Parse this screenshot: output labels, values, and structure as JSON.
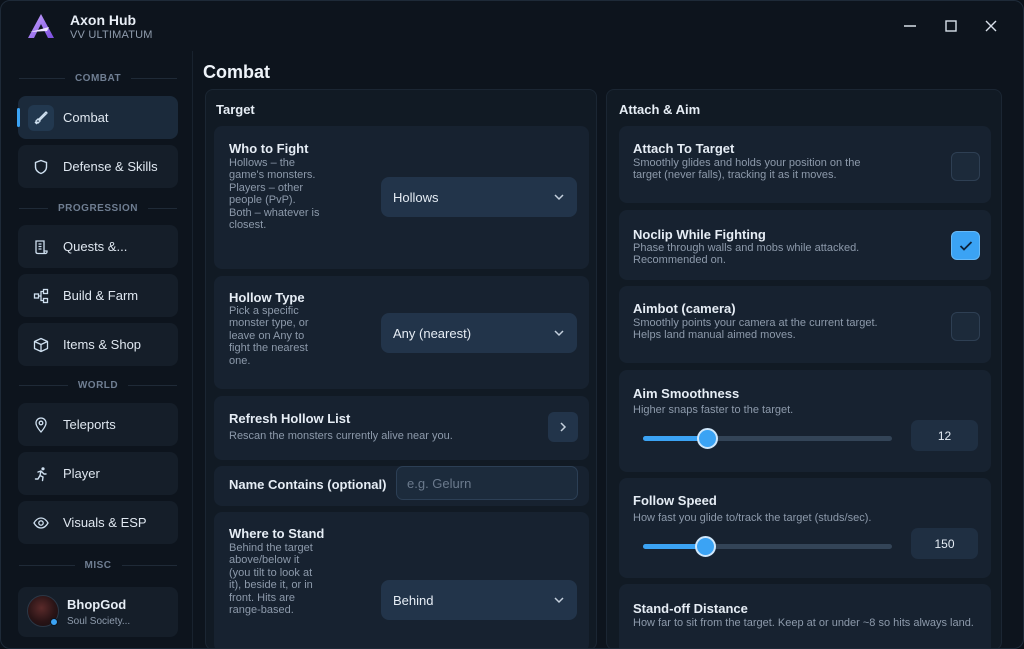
{
  "app": {
    "title": "Axon Hub",
    "subtitle": "VV ULTIMATUM"
  },
  "sidebar": {
    "sections": {
      "combat": "COMBAT",
      "progression": "PROGRESSION",
      "world": "WORLD",
      "misc": "MISC"
    },
    "items": [
      {
        "label": "Combat",
        "icon": "sword-icon",
        "active": true
      },
      {
        "label": "Defense & Skills",
        "icon": "shield-icon"
      },
      {
        "label": "Quests &...",
        "icon": "scroll-icon"
      },
      {
        "label": "Build & Farm",
        "icon": "nodes-icon"
      },
      {
        "label": "Items & Shop",
        "icon": "box-icon"
      },
      {
        "label": "Teleports",
        "icon": "location-pin-icon"
      },
      {
        "label": "Player",
        "icon": "running-person-icon"
      },
      {
        "label": "Visuals & ESP",
        "icon": "eye-icon"
      }
    ],
    "user": {
      "name": "BhopGod",
      "subtitle": "Soul Society..."
    }
  },
  "main": {
    "title": "Combat"
  },
  "target_panel": {
    "title": "Target",
    "who_to_fight": {
      "title": "Who to Fight",
      "description": "Hollows – the game's monsters. Players – other people (PvP). Both – whatever is closest.",
      "value": "Hollows"
    },
    "hollow_type": {
      "title": "Hollow Type",
      "description": "Pick a specific monster type, or leave on Any to fight the nearest one.",
      "value": "Any (nearest)"
    },
    "refresh": {
      "title": "Refresh Hollow List",
      "description": "Rescan the monsters currently alive near you."
    },
    "name_contains": {
      "title": "Name Contains (optional)",
      "placeholder": "e.g. Gelurn"
    },
    "where_to_stand": {
      "title": "Where to Stand",
      "description": "Behind the target above/below it (you tilt to look at it), beside it, or in front. Hits are range-based.",
      "value": "Behind"
    }
  },
  "attach_panel": {
    "title": "Attach & Aim",
    "attach": {
      "title": "Attach To Target",
      "description": "Smoothly glides and holds your position on the target (never falls), tracking it as it moves.",
      "checked": false
    },
    "noclip": {
      "title": "Noclip While Fighting",
      "description": "Phase through walls and mobs while attacked. Recommended on.",
      "checked": true
    },
    "aimbot": {
      "title": "Aimbot (camera)",
      "description": "Smoothly points your camera at the current target. Helps land manual aimed moves.",
      "checked": false
    },
    "aim_smoothness": {
      "title": "Aim Smoothness",
      "description": "Higher snaps faster to the target.",
      "value": "12",
      "fraction": 0.26
    },
    "follow_speed": {
      "title": "Follow Speed",
      "description": "How fast you glide to/track the target (studs/sec).",
      "value": "150",
      "fraction": 0.25
    },
    "standoff": {
      "title": "Stand-off Distance",
      "description": "How far to sit from the target. Keep at or under ~8 so hits always land."
    }
  },
  "colors": {
    "accent": "#3ba3f4",
    "background": "#0d141d",
    "card": "#172230"
  }
}
